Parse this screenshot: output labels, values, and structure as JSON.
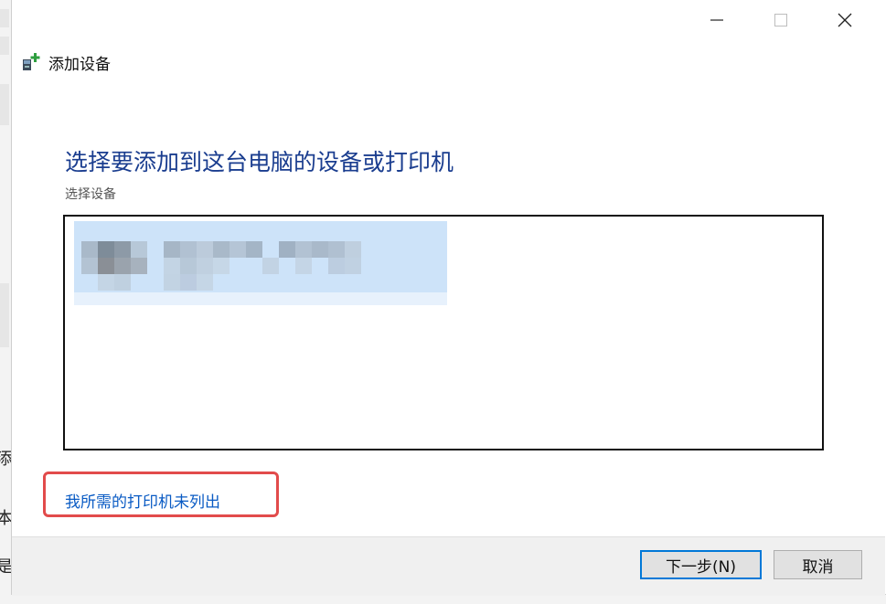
{
  "window": {
    "title": "添加设备"
  },
  "caption_buttons": {
    "minimize_icon": "minimize-icon",
    "maximize_icon": "maximize-icon",
    "close_icon": "close-icon"
  },
  "main": {
    "heading": "选择要添加到这台电脑的设备或打印机",
    "subheading": "选择设备",
    "device_list": {
      "items": [
        {
          "name": "",
          "detail": "",
          "selected": true,
          "obscured": true
        }
      ]
    },
    "not_listed_link": "我所需的打印机未列出"
  },
  "footer": {
    "next_label": "下一步(N)",
    "cancel_label": "取消"
  },
  "background": {
    "edge_chars": [
      "添",
      "本",
      "是"
    ]
  },
  "colors": {
    "heading": "#1a3d8f",
    "link": "#0a5bc4",
    "selection": "#cde3f9",
    "highlight_box": "#e24b4b",
    "default_button_border": "#0078d7"
  }
}
